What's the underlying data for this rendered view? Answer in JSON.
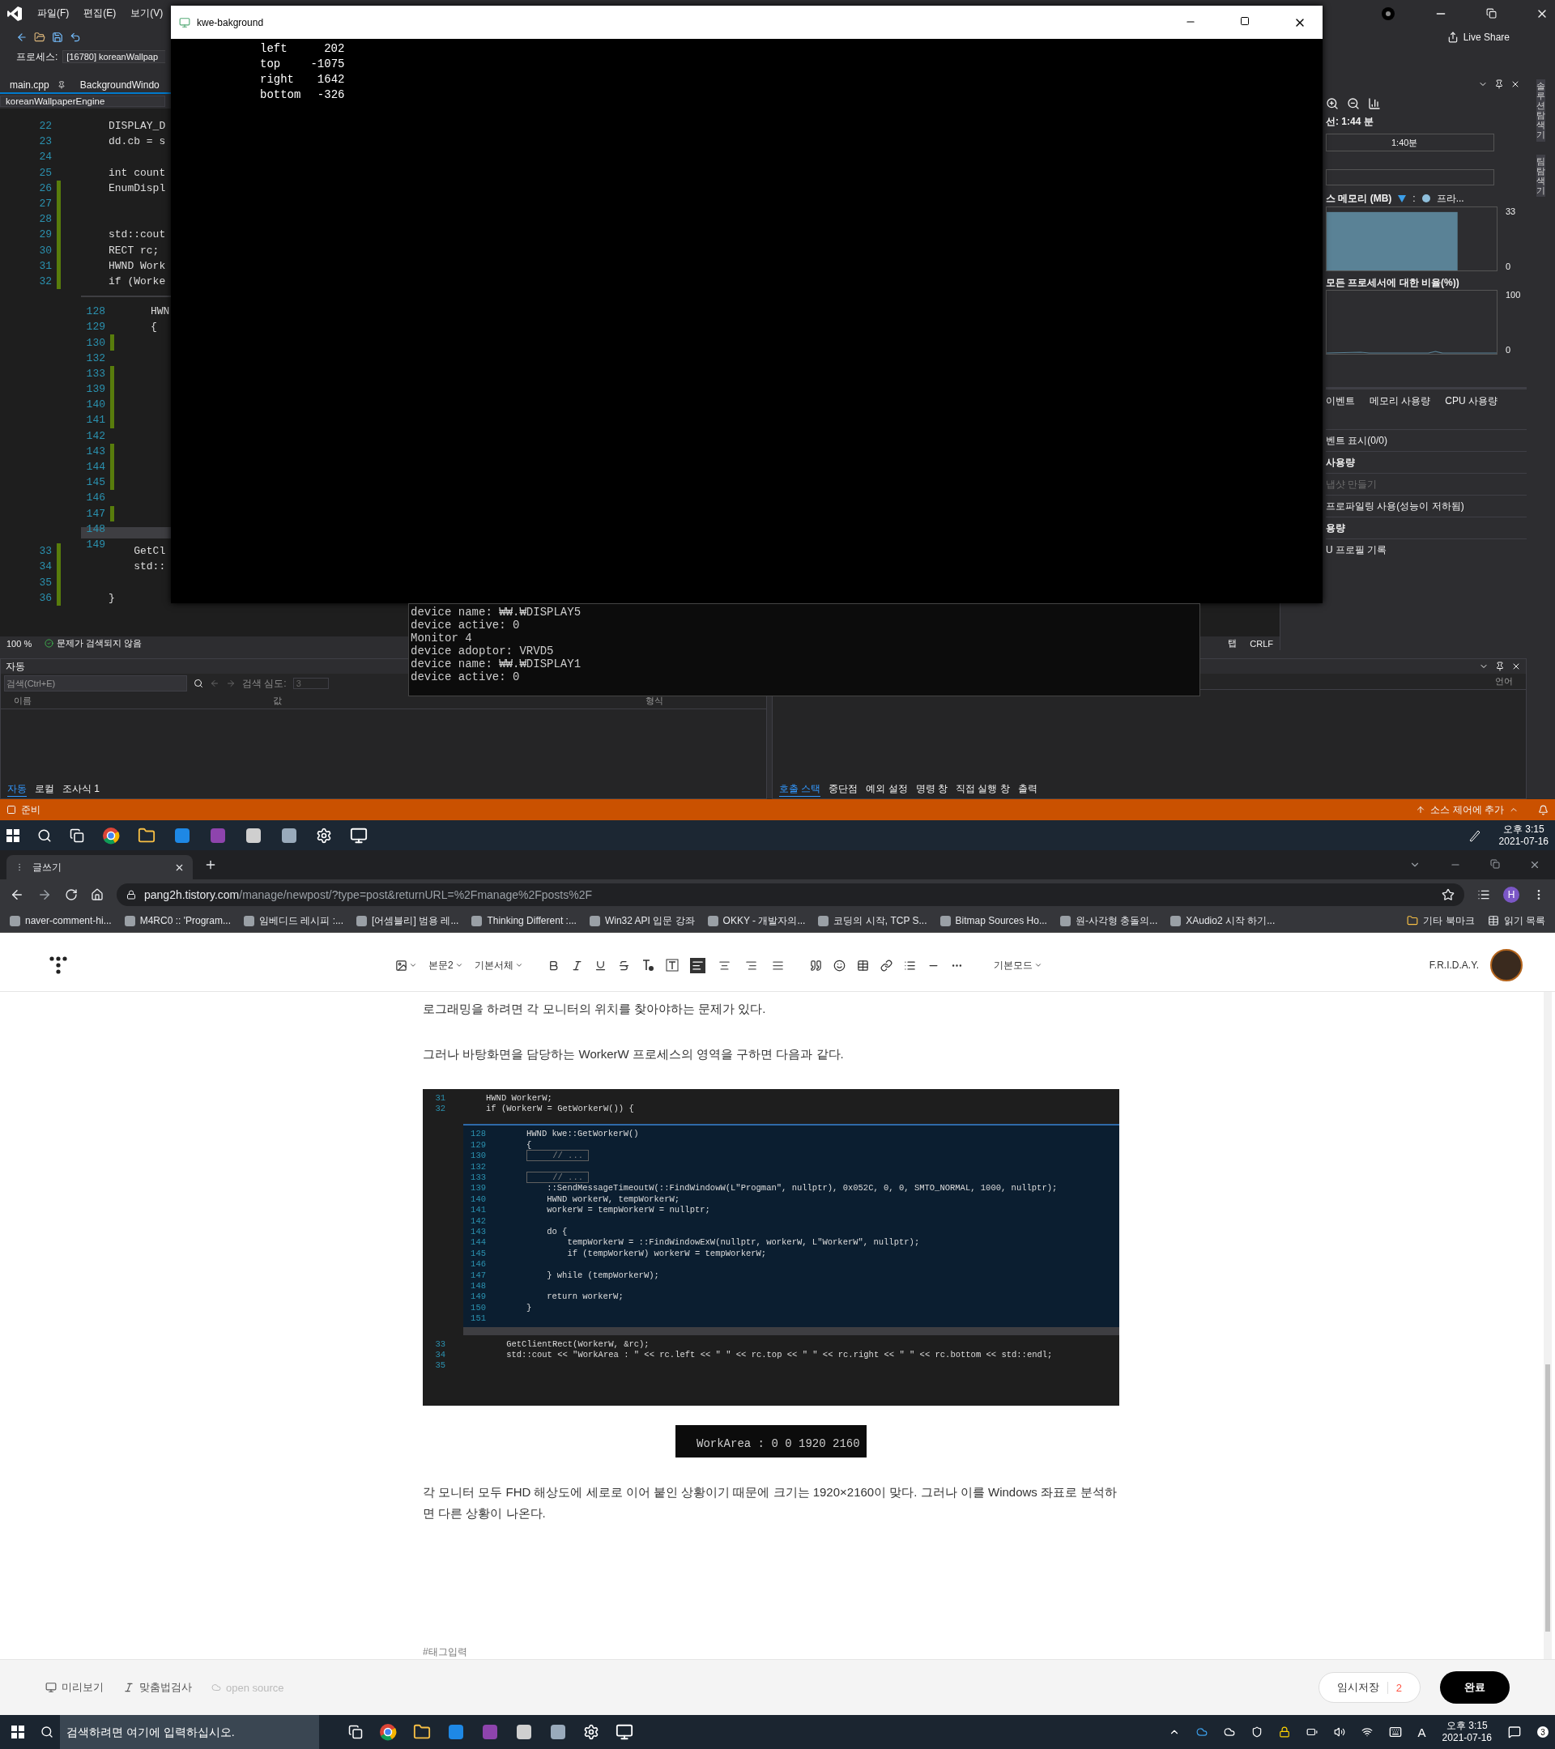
{
  "vs": {
    "menu": [
      "파일(F)",
      "편집(E)",
      "보기(V)"
    ],
    "live_share": "Live Share",
    "process": {
      "label": "프로세스:",
      "value": "[16780] koreanWallpap"
    },
    "tabs": [
      {
        "label": "main.cpp",
        "pinned": true
      },
      {
        "label": "BackgroundWindo",
        "pinned": false
      }
    ],
    "nav": "koreanWallpaperEngine",
    "code_top": [
      {
        "number": "22",
        "text": "DISPLAY_D",
        "changed": false
      },
      {
        "number": "23",
        "text": "dd.cb = s",
        "changed": false
      },
      {
        "number": "24",
        "changed": false
      },
      {
        "number": "25",
        "text": "int count",
        "changed": false
      },
      {
        "number": "26",
        "text": "EnumDispl",
        "changed": true
      },
      {
        "number": "27",
        "changed": true
      },
      {
        "number": "28",
        "changed": true
      },
      {
        "number": "29",
        "text": "std::cout",
        "changed": true
      },
      {
        "number": "30",
        "text": "RECT rc;",
        "changed": true
      },
      {
        "number": "31",
        "text": "HWND Work",
        "changed": true
      },
      {
        "number": "32",
        "text": "if (Worke",
        "changed": true
      }
    ],
    "code_peek": [
      {
        "number": "128",
        "text": "HWN",
        "changed": false
      },
      {
        "number": "129",
        "text": "{",
        "changed": false
      },
      {
        "number": "130",
        "changed": true
      },
      {
        "number": "132",
        "changed": false
      },
      {
        "number": "133",
        "changed": true
      },
      {
        "number": "139",
        "changed": true
      },
      {
        "number": "140",
        "changed": true
      },
      {
        "number": "141",
        "changed": true
      },
      {
        "number": "142",
        "changed": false
      },
      {
        "number": "143",
        "changed": true
      },
      {
        "number": "144",
        "changed": true
      },
      {
        "number": "145",
        "changed": true
      },
      {
        "number": "146",
        "changed": false
      },
      {
        "number": "147",
        "changed": true
      },
      {
        "number": "148",
        "changed": false
      },
      {
        "number": "149",
        "changed": false
      }
    ],
    "code_bottom": [
      {
        "number": "33",
        "text": "    GetCl",
        "changed": true
      },
      {
        "number": "34",
        "text": "    std::",
        "changed": true
      },
      {
        "number": "35",
        "changed": true
      },
      {
        "number": "36",
        "text": "}",
        "changed": true
      }
    ],
    "zoom": "100 %",
    "issues": "문제가 검색되지 않음",
    "status_right": [
      "탭",
      "CRLF"
    ],
    "diag": {
      "session": "선: 1:44 분",
      "ruler_label": "1:40분",
      "memory_title": "스 메모리 (MB)",
      "legend_sep": ":",
      "legend_label": "프라...",
      "memory_axis": [
        "33",
        "0"
      ],
      "cpu_title": "모든 프로세서에 대한 비율(%))",
      "cpu_axis": [
        "100",
        "0"
      ],
      "tabs": [
        "이벤트",
        "메모리 사용량",
        "CPU 사용량"
      ],
      "rows": [
        {
          "text": "벤트 표시(0/0)",
          "kind": "item"
        },
        {
          "text": "사용량",
          "kind": "heading"
        },
        {
          "text": "냅샷 만들기",
          "kind": "disabled"
        },
        {
          "text": "프로파일링 사용(성능이 저하됨)",
          "kind": "item"
        },
        {
          "text": "용량",
          "kind": "heading"
        },
        {
          "text": "U 프로필 기록",
          "kind": "item"
        }
      ]
    },
    "side_tabs": [
      "솔루션 탐색기",
      "팀 탐색기"
    ],
    "autos": {
      "title": "자동",
      "search_placeholder": "검색(Ctrl+E)",
      "depth_label": "검색 심도:",
      "depth_value": "3",
      "columns": [
        "이름",
        "값",
        "형식"
      ],
      "tabs": [
        {
          "label": "자동",
          "selected": true
        },
        {
          "label": "로컬",
          "selected": false
        },
        {
          "label": "조사식 1",
          "selected": false
        }
      ]
    },
    "calls": {
      "column": "언어",
      "tabs": [
        {
          "label": "호출 스택",
          "selected": true
        },
        {
          "label": "중단점",
          "selected": false
        },
        {
          "label": "예외 설정",
          "selected": false
        },
        {
          "label": "명령 창",
          "selected": false
        },
        {
          "label": "직접 실행 창",
          "selected": false
        },
        {
          "label": "출력",
          "selected": false
        }
      ]
    },
    "status": {
      "text": "준비",
      "source_control": "소스 제어에 추가"
    }
  },
  "console": {
    "title": "kwe-bakground",
    "rows": [
      {
        "label": "left",
        "value": "202"
      },
      {
        "label": "top",
        "value": "-1075"
      },
      {
        "label": "right",
        "value": "1642"
      },
      {
        "label": "bottom",
        "value": "-326"
      }
    ]
  },
  "output_console": {
    "lines": [
      "device name: ₩₩.₩DISPLAY5",
      "device active: 0",
      "Monitor 4",
      "device adoptor: VRVD5",
      "device name: ₩₩.₩DISPLAY1",
      "device active: 0"
    ]
  },
  "taskbar_top": {
    "time": "오후 3:15",
    "date": "2021-07-16"
  },
  "browser": {
    "tab_title": "글쓰기",
    "url_host": "pang2h.tistory.com",
    "url_path": "/manage/newpost/?type=post&returnURL=%2Fmanage%2Fposts%2F",
    "avatar": "H",
    "bookmarks": [
      "naver-comment-hi...",
      "M4RC0 :: 'Program...",
      "임베디드 레시피 :...",
      "[어셈블리] 범용 레...",
      "Thinking Different :...",
      "Win32 API 입문 강좌",
      "OKKY - 개발자의...",
      "코딩의 시작, TCP S...",
      "Bitmap Sources Ho...",
      "원-사각형 충돌의...",
      "XAudio2 시작 하기..."
    ],
    "other_bookmarks": "기타 북마크",
    "reading_list": "읽기 목록"
  },
  "editor": {
    "style": "본문2",
    "font": "기본서체",
    "align": [
      {
        "selected": true
      },
      {
        "selected": false
      },
      {
        "selected": false
      },
      {
        "selected": false
      }
    ],
    "mode": "기본모드",
    "blog": "F.R.I.D.A.Y.",
    "paragraphs": [
      "로그래밍을 하려면 각 모니터의 위치를 찾아야하는 문제가 있다.",
      " 그러나 바탕화면을 담당하는 WorkerW 프로세스의 영역을 구하면 다음과 같다."
    ],
    "code_top": [
      {
        "number": "31",
        "text": "HWND WorkerW;",
        "kind": "code"
      },
      {
        "number": "32",
        "text": "if (WorkerW = GetWorkerW()) {",
        "kind": "code"
      }
    ],
    "code_peek": [
      {
        "number": "128",
        "text": "HWND kwe::GetWorkerW()",
        "kind": "code"
      },
      {
        "number": "129",
        "text": "{",
        "kind": "code"
      },
      {
        "number": "130",
        "text": "    // ...",
        "kind": "collapsed"
      },
      {
        "number": "132"
      },
      {
        "number": "133",
        "text": "    // ...",
        "kind": "collapsed"
      },
      {
        "number": "139",
        "text": "    ::SendMessageTimeoutW(::FindWindowW(L\"Progman\", nullptr), 0x052C, 0, 0, SMTO_NORMAL, 1000, nullptr);",
        "kind": "code"
      },
      {
        "number": "140",
        "text": "    HWND workerW, tempWorkerW;",
        "kind": "code"
      },
      {
        "number": "141",
        "text": "    workerW = tempWorkerW = nullptr;",
        "kind": "code"
      },
      {
        "number": "142"
      },
      {
        "number": "143",
        "text": "    do {",
        "kind": "code"
      },
      {
        "number": "144",
        "text": "        tempWorkerW = ::FindWindowExW(nullptr, workerW, L\"WorkerW\", nullptr);",
        "kind": "code"
      },
      {
        "number": "145",
        "text": "        if (tempWorkerW) workerW = tempWorkerW;",
        "kind": "code"
      },
      {
        "number": "146"
      },
      {
        "number": "147",
        "text": "    } while (tempWorkerW);",
        "kind": "code"
      },
      {
        "number": "148"
      },
      {
        "number": "149",
        "text": "    return workerW;",
        "kind": "code"
      },
      {
        "number": "150",
        "text": "}",
        "kind": "code"
      },
      {
        "number": "151"
      }
    ],
    "code_bottom": [
      {
        "number": "33",
        "text": "    GetClientRect(WorkerW, &rc);",
        "kind": "code"
      },
      {
        "number": "34",
        "text": "    std::cout << \"WorkArea : \" << rc.left << \" \" << rc.top << \" \" << rc.right << \" \" << rc.bottom << std::endl;",
        "kind": "code"
      },
      {
        "number": "35"
      }
    ],
    "console_image": "WorkArea : 0 0 1920 2160",
    "paragraph_after": " 각 모니터 모두 FHD 해상도에 세로로 이어 붙인 상황이기 때문에 크기는 1920×2160이 맞다. 그러나 이를 Windows 좌표로 분석하면 다른 상황이 나온다.",
    "tag_placeholder": "#태그입력"
  },
  "bottom_bar": {
    "preview": "미리보기",
    "spell": "맞춤법검사",
    "open_source": "open source",
    "save": "임시저장",
    "save_count": "2",
    "publish": "완료"
  },
  "taskbar_bottom": {
    "search_placeholder": "검색하려면 여기에 입력하십시오.",
    "ime": "A",
    "time": "오후 3:15",
    "date": "2021-07-16",
    "notifications": "3"
  }
}
